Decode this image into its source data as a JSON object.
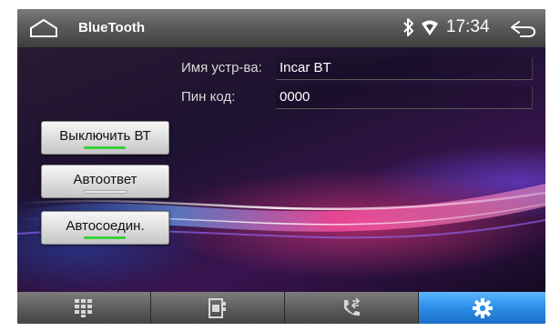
{
  "statusbar": {
    "title": "BlueTooth",
    "time": "17:34",
    "icons": [
      "home-icon",
      "bluetooth-icon",
      "wifi-icon",
      "back-icon"
    ]
  },
  "device": {
    "name_label": "Имя устр-ва:",
    "name_value": "Incar BT",
    "pin_label": "Пин код:",
    "pin_value": "0000"
  },
  "buttons": {
    "bt_off_label": "Выключить ВТ",
    "auto_answer_label": "Автоответ",
    "auto_connect_label": "Автосоедин."
  },
  "indicators": {
    "on_color": "#3ccf3c",
    "off_color": "#e8e8e8"
  },
  "tabs": [
    "keypad-icon",
    "phonebook-icon",
    "call-log-icon",
    "settings-icon"
  ],
  "colors": {
    "active_tab": "#2a8ee8"
  }
}
